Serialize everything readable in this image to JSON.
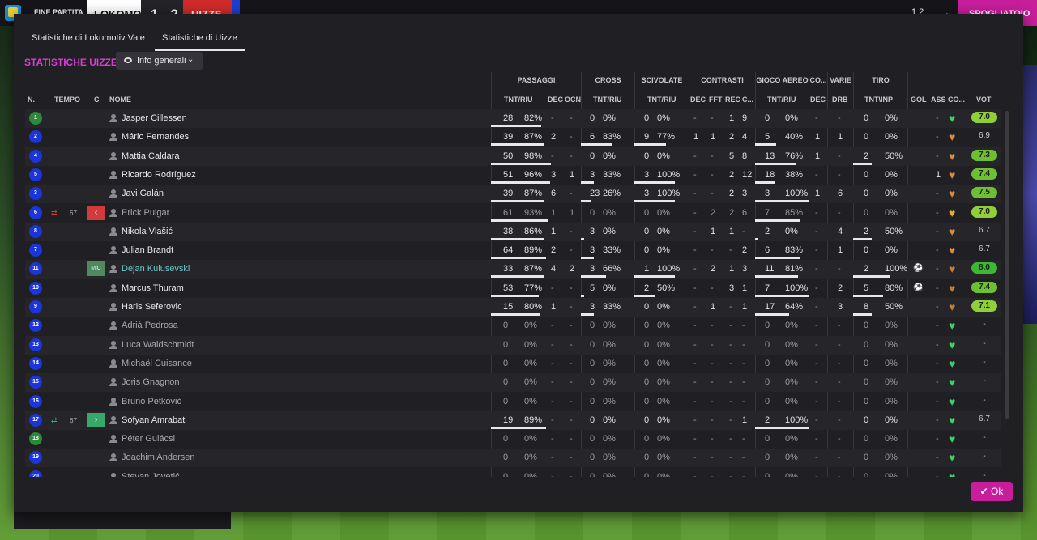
{
  "topbar": {
    "match_status": "FINE PARTITA",
    "home": "LOKOMO",
    "score": "1 - 2",
    "away": "UIZZE",
    "count": "1 2",
    "chevron": "⌄",
    "dressing_room": "SPOGLIATOIO"
  },
  "tabs": [
    "Statistiche di Lokomotiv Vale",
    "Statistiche di Uizze"
  ],
  "section_title": "STATISTICHE UIZZE",
  "dropdown": {
    "label": "Info generali",
    "icon": "eye-icon",
    "chevron": "⌄"
  },
  "groups": [
    "PASSAGGI",
    "CROSS",
    "SCIVOLATE",
    "CONTRASTI",
    "GIOCO AEREO",
    "CO...",
    "VARIE",
    "TIRO"
  ],
  "columns": {
    "n": "N.",
    "tempo": "TEMPO",
    "c": "C",
    "nome": "NOME",
    "pass_tr": "TNT/RIU",
    "pass_dec": "DEC",
    "pass_ocn": "OCN",
    "cross_tr": "TNT/RIU",
    "sciv_tr": "TNT/RIU",
    "con_dec": "DEC",
    "con_fft": "FFT",
    "con_rec": "REC",
    "con_c": "C...",
    "aereo_tr": "TNT/RIU",
    "co_dec": "DEC",
    "var_drb": "DRB",
    "tiro_ti": "TNT\\INP",
    "gol": "GOL",
    "ass": "ASS",
    "co": "CO...",
    "vot": "VOT"
  },
  "colors": {
    "accent": "#c81e9c",
    "title": "#d43fcf",
    "highlight_name": "#6ac7c8"
  },
  "rows": [
    {
      "n": "1",
      "gk": true,
      "tempo": "",
      "chip": "",
      "name": "Jasper Cillessen",
      "style": "",
      "pt": "28",
      "pp": "82%",
      "pd": "-",
      "po": "-",
      "ct": "0",
      "cp": "0%",
      "st": "0",
      "sp": "0%",
      "d1": "-",
      "d2": "-",
      "d3": "1",
      "d4": "9",
      "at": "0",
      "ap": "0%",
      "cd": "-",
      "dr": "-",
      "tt": "0",
      "tp": "0%",
      "gol": "",
      "ass": "-",
      "heart": "#3ccf6a",
      "vot": "7.0",
      "vc": "#8fd038"
    },
    {
      "n": "2",
      "gk": false,
      "tempo": "",
      "chip": "",
      "name": "Mário Fernandes",
      "style": "",
      "pt": "39",
      "pp": "87%",
      "pd": "2",
      "po": "-",
      "ct": "6",
      "cp": "83%",
      "st": "9",
      "sp": "77%",
      "d1": "1",
      "d2": "1",
      "d3": "2",
      "d4": "4",
      "at": "5",
      "ap": "40%",
      "cd": "1",
      "dr": "1",
      "tt": "0",
      "tp": "0%",
      "gol": "",
      "ass": "-",
      "heart": "#d98a3a",
      "vot": "6.9",
      "vc": ""
    },
    {
      "n": "4",
      "gk": false,
      "tempo": "",
      "chip": "",
      "name": "Mattia Caldara",
      "style": "",
      "pt": "50",
      "pp": "98%",
      "pd": "-",
      "po": "-",
      "ct": "0",
      "cp": "0%",
      "st": "0",
      "sp": "0%",
      "d1": "-",
      "d2": "-",
      "d3": "5",
      "d4": "8",
      "at": "13",
      "ap": "76%",
      "cd": "1",
      "dr": "-",
      "tt": "2",
      "tp": "50%",
      "gol": "",
      "ass": "-",
      "heart": "#d98a3a",
      "vot": "7.3",
      "vc": "#6fbf32"
    },
    {
      "n": "5",
      "gk": false,
      "tempo": "",
      "chip": "",
      "name": "Ricardo Rodríguez",
      "style": "",
      "pt": "51",
      "pp": "96%",
      "pd": "3",
      "po": "1",
      "ct": "3",
      "cp": "33%",
      "st": "3",
      "sp": "100%",
      "d1": "-",
      "d2": "-",
      "d3": "2",
      "d4": "12",
      "at": "18",
      "ap": "38%",
      "cd": "-",
      "dr": "-",
      "tt": "0",
      "tp": "0%",
      "gol": "",
      "ass": "1",
      "heart": "#d98a3a",
      "vot": "7.4",
      "vc": "#6fbf32"
    },
    {
      "n": "3",
      "gk": false,
      "tempo": "",
      "chip": "",
      "name": "Javi Galán",
      "style": "",
      "pt": "39",
      "pp": "87%",
      "pd": "6",
      "po": "-",
      "ct": "23",
      "cp": "26%",
      "st": "3",
      "sp": "100%",
      "d1": "-",
      "d2": "-",
      "d3": "2",
      "d4": "3",
      "at": "3",
      "ap": "100%",
      "cd": "1",
      "dr": "6",
      "tt": "0",
      "tp": "0%",
      "gol": "",
      "ass": "-",
      "heart": "#d98a3a",
      "vot": "7.5",
      "vc": "#6fbf32"
    },
    {
      "n": "6",
      "gk": false,
      "tempo": "67",
      "chip": "out",
      "name": "Erick Pulgar",
      "style": "sub",
      "pt": "61",
      "pp": "93%",
      "pd": "1",
      "po": "1",
      "ct": "0",
      "cp": "0%",
      "st": "0",
      "sp": "0%",
      "d1": "-",
      "d2": "2",
      "d3": "2",
      "d4": "6",
      "at": "7",
      "ap": "85%",
      "cd": "-",
      "dr": "-",
      "tt": "0",
      "tp": "0%",
      "gol": "",
      "ass": "-",
      "heart": "#e0b030",
      "vot": "7.0",
      "vc": "#8fd038"
    },
    {
      "n": "8",
      "gk": false,
      "tempo": "",
      "chip": "",
      "name": "Nikola Vlašić",
      "style": "",
      "pt": "38",
      "pp": "86%",
      "pd": "1",
      "po": "-",
      "ct": "3",
      "cp": "0%",
      "st": "0",
      "sp": "0%",
      "d1": "-",
      "d2": "1",
      "d3": "1",
      "d4": "-",
      "at": "2",
      "ap": "0%",
      "cd": "-",
      "dr": "4",
      "tt": "2",
      "tp": "50%",
      "gol": "",
      "ass": "-",
      "heart": "#d98a3a",
      "vot": "6.7",
      "vc": ""
    },
    {
      "n": "7",
      "gk": false,
      "tempo": "",
      "chip": "",
      "name": "Julian Brandt",
      "style": "",
      "pt": "64",
      "pp": "89%",
      "pd": "2",
      "po": "-",
      "ct": "3",
      "cp": "33%",
      "st": "0",
      "sp": "0%",
      "d1": "-",
      "d2": "-",
      "d3": "-",
      "d4": "2",
      "at": "6",
      "ap": "83%",
      "cd": "-",
      "dr": "1",
      "tt": "0",
      "tp": "0%",
      "gol": "",
      "ass": "-",
      "heart": "#d98a3a",
      "vot": "6.7",
      "vc": ""
    },
    {
      "n": "11",
      "gk": false,
      "tempo": "",
      "chip": "pos",
      "chip_text": "MiC",
      "name": "Dejan Kulusevski",
      "style": "hl",
      "pt": "33",
      "pp": "87%",
      "pd": "4",
      "po": "2",
      "ct": "3",
      "cp": "66%",
      "st": "1",
      "sp": "100%",
      "d1": "-",
      "d2": "2",
      "d3": "1",
      "d4": "3",
      "at": "11",
      "ap": "81%",
      "cd": "-",
      "dr": "-",
      "tt": "2",
      "tp": "100%",
      "gol": "⚽",
      "ass": "-",
      "heart": "#c87a3a",
      "vot": "8.0",
      "vc": "#3cb832"
    },
    {
      "n": "10",
      "gk": false,
      "tempo": "",
      "chip": "",
      "name": "Marcus Thuram",
      "style": "",
      "pt": "53",
      "pp": "77%",
      "pd": "-",
      "po": "-",
      "ct": "5",
      "cp": "0%",
      "st": "2",
      "sp": "50%",
      "d1": "-",
      "d2": "-",
      "d3": "3",
      "d4": "1",
      "at": "7",
      "ap": "100%",
      "cd": "-",
      "dr": "2",
      "tt": "5",
      "tp": "80%",
      "gol": "⚽",
      "ass": "-",
      "heart": "#c87a3a",
      "vot": "7.4",
      "vc": "#6fbf32"
    },
    {
      "n": "9",
      "gk": false,
      "tempo": "",
      "chip": "",
      "name": "Haris Seferovic",
      "style": "",
      "pt": "15",
      "pp": "80%",
      "pd": "1",
      "po": "-",
      "ct": "3",
      "cp": "33%",
      "st": "0",
      "sp": "0%",
      "d1": "-",
      "d2": "1",
      "d3": "-",
      "d4": "1",
      "at": "17",
      "ap": "64%",
      "cd": "-",
      "dr": "3",
      "tt": "8",
      "tp": "50%",
      "gol": "",
      "ass": "-",
      "heart": "#c87a3a",
      "vot": "7.1",
      "vc": "#8fd038"
    },
    {
      "n": "12",
      "gk": false,
      "tempo": "",
      "chip": "",
      "name": "Adrià Pedrosa",
      "style": "sub",
      "pt": "0",
      "pp": "0%",
      "pd": "-",
      "po": "-",
      "ct": "0",
      "cp": "0%",
      "st": "0",
      "sp": "0%",
      "d1": "-",
      "d2": "-",
      "d3": "-",
      "d4": "-",
      "at": "0",
      "ap": "0%",
      "cd": "-",
      "dr": "-",
      "tt": "0",
      "tp": "0%",
      "gol": "",
      "ass": "-",
      "heart": "#3ccf6a",
      "vot": "-",
      "vc": ""
    },
    {
      "n": "13",
      "gk": false,
      "tempo": "",
      "chip": "",
      "name": "Luca Waldschmidt",
      "style": "sub",
      "pt": "0",
      "pp": "0%",
      "pd": "-",
      "po": "-",
      "ct": "0",
      "cp": "0%",
      "st": "0",
      "sp": "0%",
      "d1": "-",
      "d2": "-",
      "d3": "-",
      "d4": "-",
      "at": "0",
      "ap": "0%",
      "cd": "-",
      "dr": "-",
      "tt": "0",
      "tp": "0%",
      "gol": "",
      "ass": "-",
      "heart": "#3ccf6a",
      "vot": "-",
      "vc": ""
    },
    {
      "n": "14",
      "gk": false,
      "tempo": "",
      "chip": "",
      "name": "Michaël Cuisance",
      "style": "sub",
      "pt": "0",
      "pp": "0%",
      "pd": "-",
      "po": "-",
      "ct": "0",
      "cp": "0%",
      "st": "0",
      "sp": "0%",
      "d1": "-",
      "d2": "-",
      "d3": "-",
      "d4": "-",
      "at": "0",
      "ap": "0%",
      "cd": "-",
      "dr": "-",
      "tt": "0",
      "tp": "0%",
      "gol": "",
      "ass": "-",
      "heart": "#3ccf6a",
      "vot": "-",
      "vc": ""
    },
    {
      "n": "15",
      "gk": false,
      "tempo": "",
      "chip": "",
      "name": "Joris Gnagnon",
      "style": "sub",
      "pt": "0",
      "pp": "0%",
      "pd": "-",
      "po": "-",
      "ct": "0",
      "cp": "0%",
      "st": "0",
      "sp": "0%",
      "d1": "-",
      "d2": "-",
      "d3": "-",
      "d4": "-",
      "at": "0",
      "ap": "0%",
      "cd": "-",
      "dr": "-",
      "tt": "0",
      "tp": "0%",
      "gol": "",
      "ass": "-",
      "heart": "#3ccf6a",
      "vot": "-",
      "vc": ""
    },
    {
      "n": "16",
      "gk": false,
      "tempo": "",
      "chip": "",
      "name": "Bruno Petković",
      "style": "sub",
      "pt": "0",
      "pp": "0%",
      "pd": "-",
      "po": "-",
      "ct": "0",
      "cp": "0%",
      "st": "0",
      "sp": "0%",
      "d1": "-",
      "d2": "-",
      "d3": "-",
      "d4": "-",
      "at": "0",
      "ap": "0%",
      "cd": "-",
      "dr": "-",
      "tt": "0",
      "tp": "0%",
      "gol": "",
      "ass": "-",
      "heart": "#3ccf6a",
      "vot": "-",
      "vc": ""
    },
    {
      "n": "17",
      "gk": false,
      "tempo": "67",
      "chip": "in",
      "name": "Sofyan Amrabat",
      "style": "",
      "pt": "19",
      "pp": "89%",
      "pd": "-",
      "po": "-",
      "ct": "0",
      "cp": "0%",
      "st": "0",
      "sp": "0%",
      "d1": "-",
      "d2": "-",
      "d3": "-",
      "d4": "1",
      "at": "2",
      "ap": "100%",
      "cd": "-",
      "dr": "-",
      "tt": "0",
      "tp": "0%",
      "gol": "",
      "ass": "-",
      "heart": "#3ccf6a",
      "vot": "6.7",
      "vc": ""
    },
    {
      "n": "18",
      "gk": true,
      "tempo": "",
      "chip": "",
      "name": "Péter Gulácsi",
      "style": "sub",
      "pt": "0",
      "pp": "0%",
      "pd": "-",
      "po": "-",
      "ct": "0",
      "cp": "0%",
      "st": "0",
      "sp": "0%",
      "d1": "-",
      "d2": "-",
      "d3": "-",
      "d4": "-",
      "at": "0",
      "ap": "0%",
      "cd": "-",
      "dr": "-",
      "tt": "0",
      "tp": "0%",
      "gol": "",
      "ass": "-",
      "heart": "#3ccf6a",
      "vot": "-",
      "vc": ""
    },
    {
      "n": "19",
      "gk": false,
      "tempo": "",
      "chip": "",
      "name": "Joachim Andersen",
      "style": "sub",
      "pt": "0",
      "pp": "0%",
      "pd": "-",
      "po": "-",
      "ct": "0",
      "cp": "0%",
      "st": "0",
      "sp": "0%",
      "d1": "-",
      "d2": "-",
      "d3": "-",
      "d4": "-",
      "at": "0",
      "ap": "0%",
      "cd": "-",
      "dr": "-",
      "tt": "0",
      "tp": "0%",
      "gol": "",
      "ass": "-",
      "heart": "#3ccf6a",
      "vot": "-",
      "vc": ""
    },
    {
      "n": "20",
      "gk": false,
      "tempo": "",
      "chip": "",
      "name": "Stevan Jovetić",
      "style": "sub",
      "pt": "0",
      "pp": "0%",
      "pd": "-",
      "po": "-",
      "ct": "0",
      "cp": "0%",
      "st": "0",
      "sp": "0%",
      "d1": "-",
      "d2": "-",
      "d3": "-",
      "d4": "-",
      "at": "0",
      "ap": "0%",
      "cd": "-",
      "dr": "-",
      "tt": "0",
      "tp": "0%",
      "gol": "",
      "ass": "-",
      "heart": "#3ccf6a",
      "vot": "-",
      "vc": ""
    }
  ],
  "ok_button": "Ok"
}
